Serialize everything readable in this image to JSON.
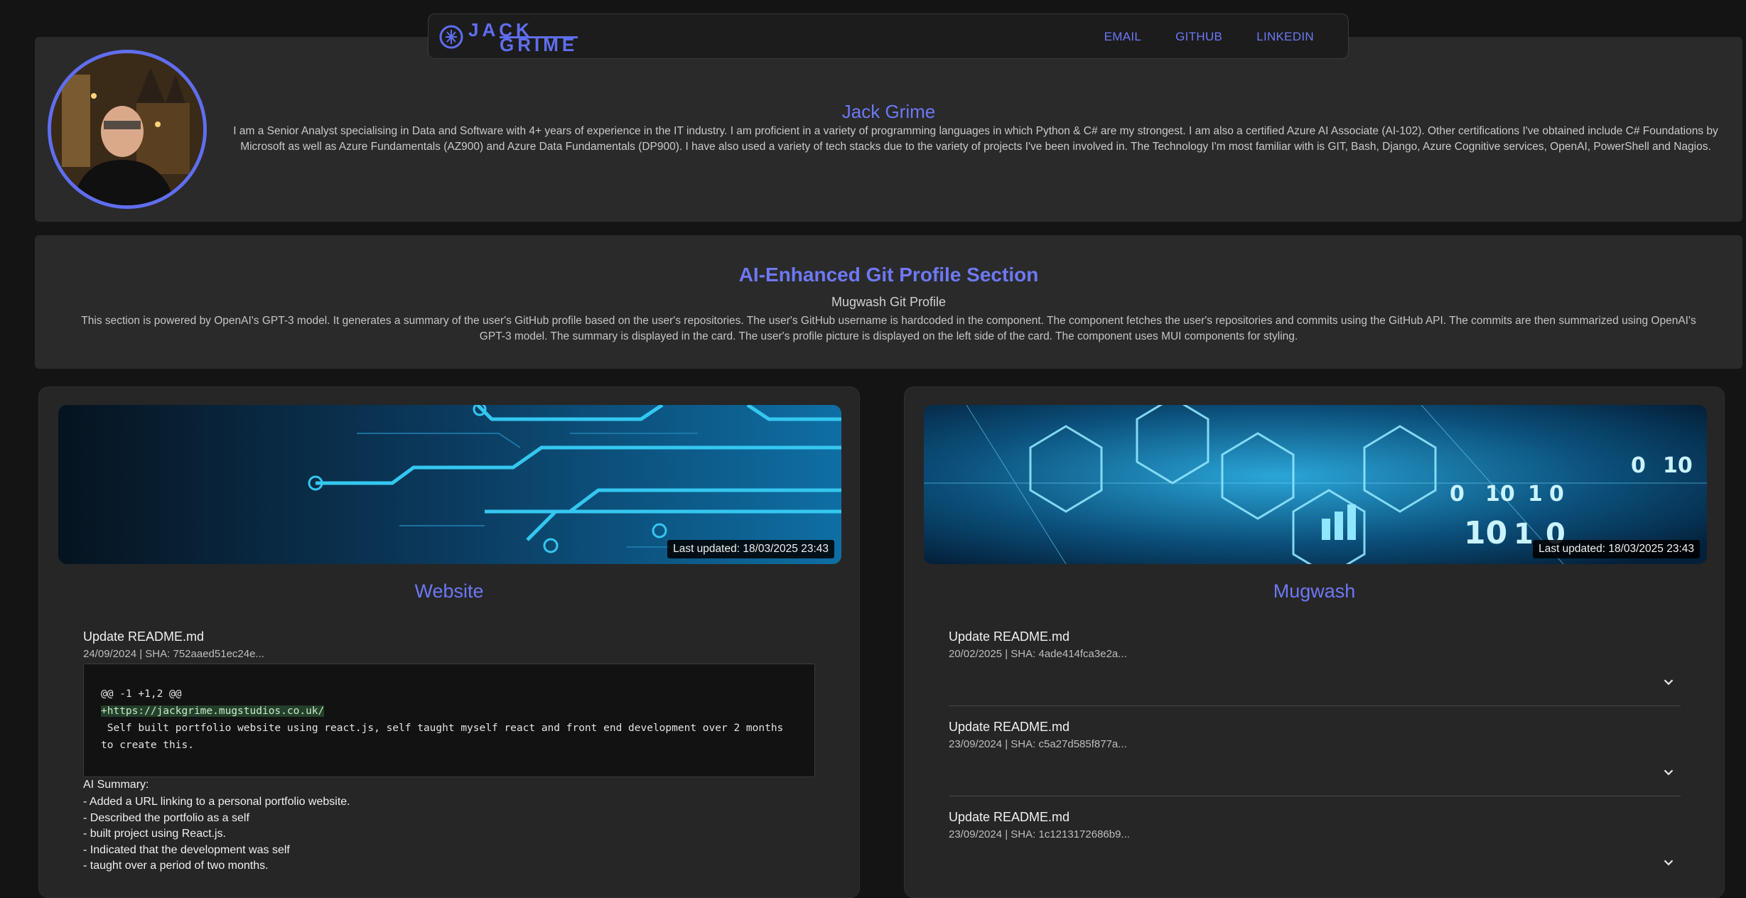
{
  "nav": {
    "logo_top": "JACK",
    "logo_bottom": "GRIME",
    "links": [
      "EMAIL",
      "GITHUB",
      "LINKEDIN"
    ]
  },
  "profile": {
    "name": "Jack Grime",
    "bio": "I am a Senior Analyst specialising in Data and Software with 4+ years of experience in the IT industry. I am proficient in a variety of programming languages in which Python & C# are my strongest. I am also a certified Azure AI Associate (AI-102). Other certifications I've obtained include C# Foundations by Microsoft as well as Azure Fundamentals (AZ900) and Azure Data Fundamentals (DP900). I have also used a variety of tech stacks due to the variety of projects I've been involved in. The Technology I'm most familiar with is GIT, Bash, Django, Azure Cognitive services, OpenAI, PowerShell and Nagios."
  },
  "ai_section": {
    "title": "AI-Enhanced Git Profile Section",
    "subtitle": "Mugwash Git Profile",
    "description": "This section is powered by OpenAI's GPT-3 model. It generates a summary of the user's GitHub profile based on the user's repositories. The user's GitHub username is hardcoded in the component. The component fetches the user's repositories and commits using the GitHub API. The commits are then summarized using OpenAI's GPT-3 model. The summary is displayed in the card. The user's profile picture is displayed on the left side of the card. The component uses MUI components for styling."
  },
  "repos": [
    {
      "name": "Website",
      "last_updated": "Last updated: 18/03/2025 23:43",
      "commits": [
        {
          "title": "Update README.md",
          "meta": "24/09/2024 |  SHA: 752aaed51ec24e...",
          "diff_header": "@@ -1 +1,2 @@",
          "diff_added": "+https://jackgrime.mugstudios.co.uk/",
          "diff_context": " Self built portfolio website using react.js, self taught myself react and front end development over 2 months to create this.",
          "ai_summary_label": "AI Summary:",
          "ai_summary": [
            "- Added a URL linking to a personal portfolio website.",
            "- Described the portfolio as a self",
            "- built project using React.js.",
            "- Indicated that the development was self",
            "- taught over a period of two months."
          ]
        }
      ]
    },
    {
      "name": "Mugwash",
      "last_updated": "Last updated: 18/03/2025 23:43",
      "commits": [
        {
          "title": "Update README.md",
          "meta": "20/02/2025 |  SHA: 4ade414fca3e2a..."
        },
        {
          "title": "Update README.md",
          "meta": "23/09/2024 |  SHA: c5a27d585f877a..."
        },
        {
          "title": "Update README.md",
          "meta": "23/09/2024 |  SHA: 1c1213172686b9..."
        }
      ]
    }
  ],
  "colors": {
    "accent": "#6d78f5",
    "background": "#141414",
    "card": "#2a2a2a"
  },
  "icons": {
    "expand": "chevron-down-icon",
    "logo": "brain-circuit-icon"
  }
}
